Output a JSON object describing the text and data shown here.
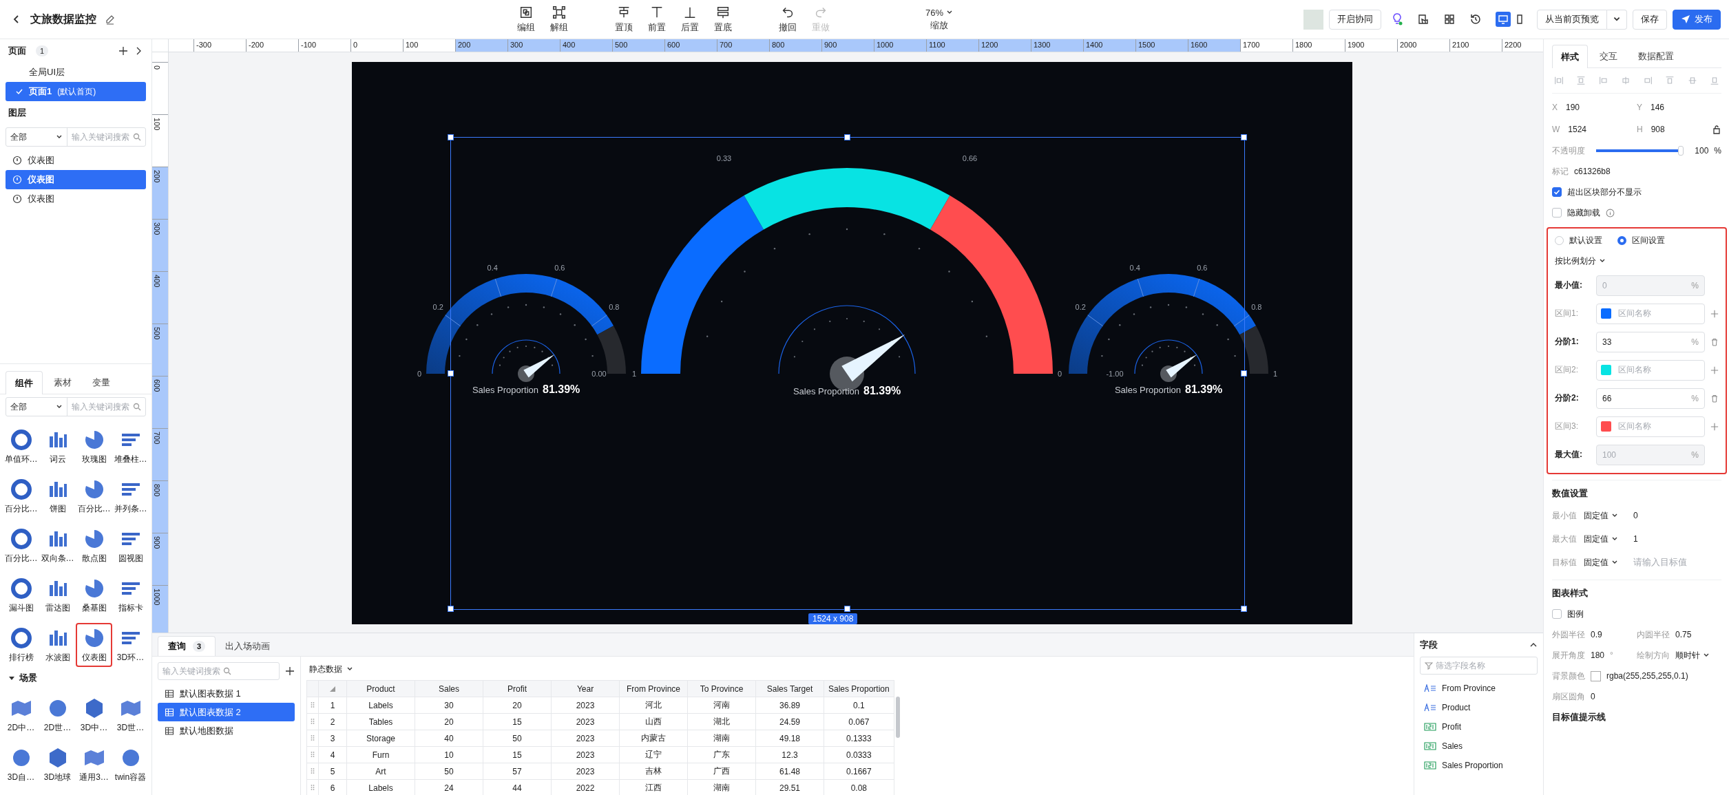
{
  "header": {
    "title": "文旅数据监控",
    "tools": [
      {
        "label": "编组",
        "disabled": false
      },
      {
        "label": "解组",
        "disabled": false
      },
      {
        "label": "置顶",
        "disabled": false
      },
      {
        "label": "前置",
        "disabled": false
      },
      {
        "label": "后置",
        "disabled": false
      },
      {
        "label": "置底",
        "disabled": false
      },
      {
        "label": "撤回",
        "disabled": false
      },
      {
        "label": "重做",
        "disabled": true
      }
    ],
    "zoom": {
      "value": "76%",
      "label": "缩放"
    },
    "collab_button": "开启协同",
    "devices": [
      {
        "selected": true
      },
      {
        "selected": false
      }
    ],
    "preview_button": "从当前页预览",
    "save_button": "保存",
    "publish_button": "发布"
  },
  "pages": {
    "title": "页面",
    "count": "1",
    "items": [
      {
        "label": "全局UI层",
        "selected": false
      },
      {
        "label": "页面1",
        "note": "(默认首页)",
        "selected": true
      }
    ]
  },
  "layers": {
    "title": "图层",
    "filter": "全部",
    "search": {
      "placeholder": "输入关键词搜索"
    },
    "items": [
      {
        "label": "仪表图",
        "selected": false
      },
      {
        "label": "仪表图",
        "selected": true
      },
      {
        "label": "仪表图",
        "selected": false
      }
    ]
  },
  "library": {
    "tabs": [
      {
        "label": "组件",
        "selected": true
      },
      {
        "label": "素材",
        "selected": false
      },
      {
        "label": "变量",
        "selected": false
      }
    ],
    "filter": "全部",
    "search": {
      "placeholder": "输入关键词搜索"
    },
    "components": [
      {
        "label": "单值环…",
        "highlighted": false
      },
      {
        "label": "词云",
        "highlighted": false
      },
      {
        "label": "玫瑰图",
        "highlighted": false
      },
      {
        "label": "堆叠柱…",
        "highlighted": false
      },
      {
        "label": "百分比…",
        "highlighted": false
      },
      {
        "label": "饼图",
        "highlighted": false
      },
      {
        "label": "百分比…",
        "highlighted": false
      },
      {
        "label": "并列条…",
        "highlighted": false
      },
      {
        "label": "百分比…",
        "highlighted": false
      },
      {
        "label": "双向条…",
        "highlighted": false
      },
      {
        "label": "散点图",
        "highlighted": false
      },
      {
        "label": "圆视图",
        "highlighted": false
      },
      {
        "label": "漏斗图",
        "highlighted": false
      },
      {
        "label": "雷达图",
        "highlighted": false
      },
      {
        "label": "桑基图",
        "highlighted": false
      },
      {
        "label": "指标卡",
        "highlighted": false
      },
      {
        "label": "排行榜",
        "highlighted": false
      },
      {
        "label": "水波图",
        "highlighted": false
      },
      {
        "label": "仪表图",
        "highlighted": true
      },
      {
        "label": "3D环…",
        "highlighted": false
      }
    ],
    "scene": {
      "title": "场景",
      "expanded": true,
      "items": [
        "2D中…",
        "2D世…",
        "3D中…",
        "3D世…",
        "3D自…",
        "3D地球",
        "通用3…",
        "twin容器"
      ]
    }
  },
  "ruler": {
    "horizontal": [
      {
        "label": "-300",
        "selected": false
      },
      {
        "label": "-200",
        "selected": false
      },
      {
        "label": "-100",
        "selected": false
      },
      {
        "label": "0",
        "selected": false
      },
      {
        "label": "100",
        "selected": false
      },
      {
        "label": "200",
        "selected": true
      },
      {
        "label": "300",
        "selected": true
      },
      {
        "label": "400",
        "selected": true
      },
      {
        "label": "500",
        "selected": true
      },
      {
        "label": "600",
        "selected": true
      },
      {
        "label": "700",
        "selected": true
      },
      {
        "label": "800",
        "selected": true
      },
      {
        "label": "900",
        "selected": true
      },
      {
        "label": "1000",
        "selected": true
      },
      {
        "label": "1100",
        "selected": true
      },
      {
        "label": "1200",
        "selected": true
      },
      {
        "label": "1300",
        "selected": true
      },
      {
        "label": "1400",
        "selected": true
      },
      {
        "label": "1500",
        "selected": true
      },
      {
        "label": "1600",
        "selected": true
      },
      {
        "label": "1700",
        "selected": false
      },
      {
        "label": "1800",
        "selected": false
      },
      {
        "label": "1900",
        "selected": false
      },
      {
        "label": "2000",
        "selected": false
      },
      {
        "label": "2100",
        "selected": false
      },
      {
        "label": "2200",
        "selected": false
      }
    ],
    "vertical": [
      {
        "label": "0",
        "selected": false
      },
      {
        "label": "100",
        "selected": false
      },
      {
        "label": "200",
        "selected": true
      },
      {
        "label": "300",
        "selected": true
      },
      {
        "label": "400",
        "selected": true
      },
      {
        "label": "500",
        "selected": true
      },
      {
        "label": "600",
        "selected": true
      },
      {
        "label": "700",
        "selected": true
      },
      {
        "label": "800",
        "selected": true
      },
      {
        "label": "900",
        "selected": true
      },
      {
        "label": "1000",
        "selected": true
      }
    ]
  },
  "canvas": {
    "selection_size": "1524 x 908",
    "gauges": [
      {
        "kind": "small",
        "start_label": "0",
        "ticks": [
          "0.2",
          "0.4",
          "0.6",
          "0.8"
        ],
        "inner_end_label": "0.00",
        "caption": "Sales Proportion",
        "value": "81.39%"
      },
      {
        "kind": "large",
        "start_label": "1",
        "ticks": [
          "0.33",
          "0.66"
        ],
        "end_label": "0",
        "caption": "Sales Proportion",
        "value": "81.39%"
      },
      {
        "kind": "small",
        "ticks": [
          "0.2",
          "0.4",
          "0.6",
          "0.8"
        ],
        "end_label": "1",
        "inner_start_label": "-1.00",
        "caption": "Sales Proportion",
        "value": "81.39%"
      }
    ]
  },
  "bottom": {
    "tabs": [
      {
        "label": "查询",
        "count": "3",
        "selected": true
      },
      {
        "label": "出入场动画",
        "selected": false
      }
    ],
    "search": {
      "placeholder": "输入关键词搜索"
    },
    "datasets": [
      {
        "label": "默认图表数据 1",
        "selected": false
      },
      {
        "label": "默认图表数据 2",
        "selected": true
      },
      {
        "label": "默认地图数据",
        "selected": false
      }
    ],
    "source": "静态数据",
    "table": {
      "columns": [
        "Product",
        "Sales",
        "Profit",
        "Year",
        "From Province",
        "To Province",
        "Sales Target",
        "Sales Proportion"
      ],
      "rows": [
        {
          "index": "1",
          "cells": [
            "Labels",
            "30",
            "20",
            "2023",
            "河北",
            "河南",
            "36.89",
            "0.1"
          ]
        },
        {
          "index": "2",
          "cells": [
            "Tables",
            "20",
            "15",
            "2023",
            "山西",
            "湖北",
            "24.59",
            "0.067"
          ]
        },
        {
          "index": "3",
          "cells": [
            "Storage",
            "40",
            "50",
            "2023",
            "内蒙古",
            "湖南",
            "49.18",
            "0.1333"
          ]
        },
        {
          "index": "4",
          "cells": [
            "Furn",
            "10",
            "15",
            "2023",
            "辽宁",
            "广东",
            "12.3",
            "0.0333"
          ]
        },
        {
          "index": "5",
          "cells": [
            "Art",
            "50",
            "57",
            "2023",
            "吉林",
            "广西",
            "61.48",
            "0.1667"
          ]
        },
        {
          "index": "6",
          "cells": [
            "Labels",
            "24",
            "44",
            "2022",
            "江西",
            "湖南",
            "29.51",
            "0.08"
          ]
        }
      ]
    },
    "fields": {
      "title": "字段",
      "search": {
        "placeholder": "筛选字段名称"
      },
      "items": [
        {
          "name": "From Province",
          "kind": "text"
        },
        {
          "name": "Product",
          "kind": "text"
        },
        {
          "name": "Profit",
          "kind": "number"
        },
        {
          "name": "Sales",
          "kind": "number"
        },
        {
          "name": "Sales Proportion",
          "kind": "number"
        }
      ]
    }
  },
  "inspector": {
    "tabs": [
      {
        "label": "样式",
        "selected": true
      },
      {
        "label": "交互",
        "selected": false
      },
      {
        "label": "数据配置",
        "selected": false
      }
    ],
    "position": [
      {
        "label": "X",
        "value": "190"
      },
      {
        "label": "Y",
        "value": "146"
      },
      {
        "label": "W",
        "value": "1524"
      },
      {
        "label": "H",
        "value": "908"
      }
    ],
    "opacity": {
      "label": "不透明度",
      "level": 1,
      "value": "100",
      "unit": "%"
    },
    "tag": {
      "label": "标记",
      "value": "c61326b8"
    },
    "options": [
      {
        "kind": "plain",
        "label": "超出区块部分不显示",
        "checked": true
      },
      {
        "kind": "with_info",
        "label": "隐藏卸载",
        "checked": false
      }
    ],
    "range_settings": {
      "highlighted": true,
      "modes": [
        {
          "label": "默认设置",
          "selected": false
        },
        {
          "label": "区间设置",
          "selected": true
        }
      ],
      "split": "按比例划分",
      "rows": [
        {
          "kind": "bound",
          "label": "最小值:",
          "placeholder": "0",
          "unit": "%"
        },
        {
          "kind": "range",
          "label": "区间1:",
          "color": "#0a6cff",
          "placeholder": "区间名称"
        },
        {
          "kind": "step",
          "label": "分阶1:",
          "value": "33",
          "unit": "%"
        },
        {
          "kind": "range",
          "label": "区间2:",
          "color": "#08e3e3",
          "placeholder": "区间名称"
        },
        {
          "kind": "step",
          "label": "分阶2:",
          "value": "66",
          "unit": "%"
        },
        {
          "kind": "range",
          "label": "区间3:",
          "color": "#ff4d4f",
          "placeholder": "区间名称"
        },
        {
          "kind": "bound",
          "label": "最大值:",
          "placeholder": "100",
          "unit": "%"
        }
      ]
    },
    "value_settings": {
      "title": "数值设置",
      "rows": [
        {
          "label": "最小值",
          "mode": "固定值",
          "value": "0"
        },
        {
          "label": "最大值",
          "mode": "固定值",
          "value": "1"
        },
        {
          "label": "目标值",
          "mode": "固定值",
          "placeholder": "请输入目标值"
        }
      ]
    },
    "chart_style": {
      "title": "图表样式",
      "legend": {
        "label": "图例",
        "checked": false
      },
      "rows": [
        [
          {
            "kind": "text",
            "label": "外圆半径",
            "value": "0.9"
          },
          {
            "kind": "text",
            "label": "内圆半径",
            "value": "0.75"
          }
        ],
        [
          {
            "kind": "text",
            "label": "展开角度",
            "value": "180",
            "unit": "°"
          },
          {
            "kind": "select",
            "label": "绘制方向",
            "value": "顺时针"
          }
        ],
        [
          {
            "kind": "color",
            "label": "背景颜色",
            "value": "rgba(255,255,255,0.1)"
          }
        ],
        [
          {
            "kind": "text",
            "label": "扇区圆角",
            "value": "0"
          }
        ]
      ]
    },
    "target_line": {
      "title": "目标值提示线"
    }
  }
}
